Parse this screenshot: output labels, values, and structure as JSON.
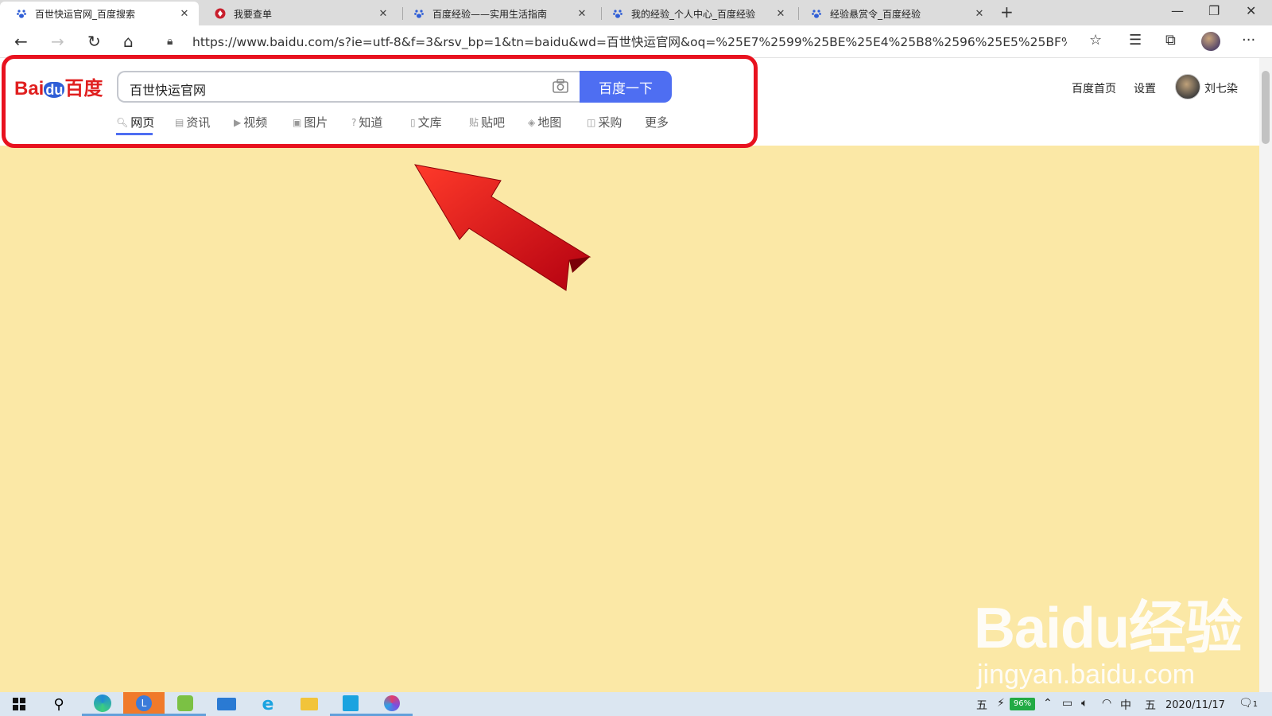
{
  "tabs": [
    {
      "label": "百世快运官网_百度搜索",
      "active": true,
      "icon": "baidu-paw-icon"
    },
    {
      "label": "我要查单",
      "active": false,
      "icon": "best-logo-icon"
    },
    {
      "label": "百度经验——实用生活指南",
      "active": false,
      "icon": "baidu-paw-icon"
    },
    {
      "label": "我的经验_个人中心_百度经验",
      "active": false,
      "icon": "baidu-paw-icon"
    },
    {
      "label": "经验悬赏令_百度经验",
      "active": false,
      "icon": "baidu-paw-icon"
    }
  ],
  "address": {
    "url": "https://www.baidu.com/s?ie=utf-8&f=3&rsv_bp=1&tn=baidu&wd=百世快运官网&oq=%25E7%2599%25BE%25E4%25B8%2596%25E5%25BF%25AB..."
  },
  "baidu": {
    "logo_left": "Bai",
    "logo_mid": "du",
    "logo_right": "百度",
    "query": "百世快运官网",
    "search_button": "百度一下",
    "nav": [
      {
        "label": "网页",
        "icon": "search-icon",
        "active": true
      },
      {
        "label": "资讯",
        "icon": "news-icon",
        "active": false
      },
      {
        "label": "视频",
        "icon": "video-icon",
        "active": false
      },
      {
        "label": "图片",
        "icon": "image-icon",
        "active": false
      },
      {
        "label": "知道",
        "icon": "question-icon",
        "active": false
      },
      {
        "label": "文库",
        "icon": "document-icon",
        "active": false
      },
      {
        "label": "贴吧",
        "icon": "tieba-icon",
        "active": false
      },
      {
        "label": "地图",
        "icon": "map-icon",
        "active": false
      },
      {
        "label": "采购",
        "icon": "purchase-icon",
        "active": false
      },
      {
        "label": "更多",
        "icon": "",
        "active": false
      }
    ],
    "home_link": "百度首页",
    "settings_link": "设置",
    "username": "刘七染"
  },
  "watermark": {
    "main": "Baidu经验",
    "sub": "jingyan.baidu.com"
  },
  "taskbar": {
    "ime_left": "五",
    "battery": "96%",
    "lang": "中",
    "ime_right": "五",
    "date": "2020/11/17",
    "notifications": "1"
  },
  "colors": {
    "highlight_box": "#e8121f",
    "search_button": "#4e6ef2",
    "page_background": "#fbe8a6"
  }
}
